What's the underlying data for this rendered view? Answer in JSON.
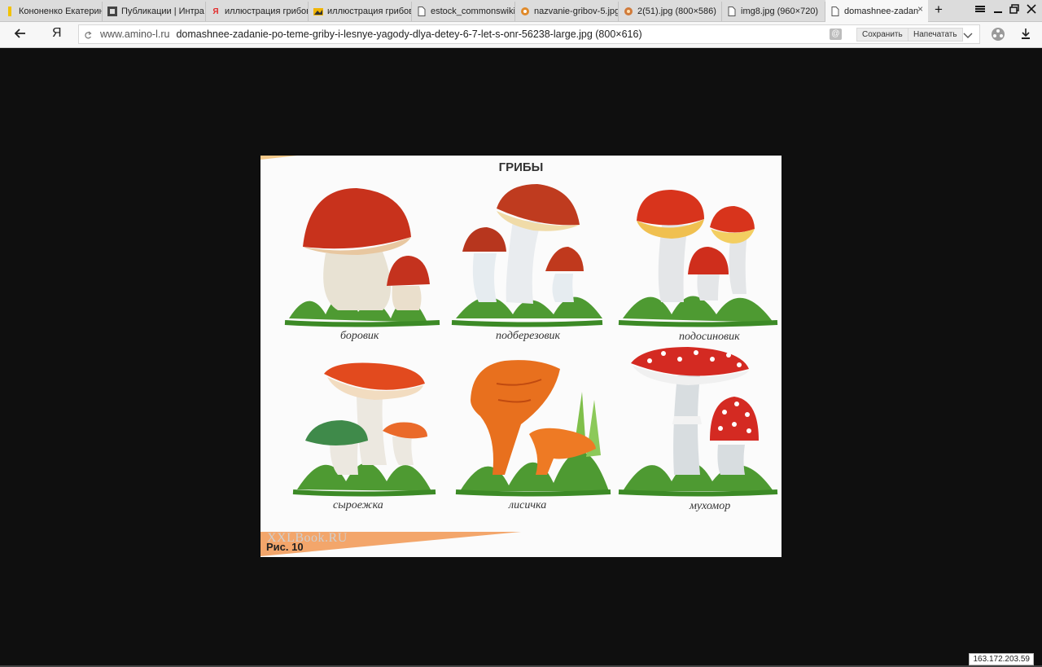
{
  "tabs": [
    {
      "label": "Кононенко Екатерин",
      "icon": "yellow-bookmark-icon",
      "color": "#f2c200"
    },
    {
      "label": "Публикации | Интра",
      "icon": "site-favicon-icon",
      "color": "#444444"
    },
    {
      "label": "иллюстрация грибов",
      "icon": "yandex-icon",
      "color": "#e22b2b"
    },
    {
      "label": "иллюстрация грибов",
      "icon": "yandex-images-icon",
      "color": "#f0b400"
    },
    {
      "label": "estock_commonswiki",
      "icon": "page-icon",
      "color": "#555555"
    },
    {
      "label": "nazvanie-gribov-5.jpg",
      "icon": "image-favicon-icon",
      "color": "#e08a2a"
    },
    {
      "label": "2(51).jpg (800×586)",
      "icon": "image-favicon-icon",
      "color": "#d07a3a"
    },
    {
      "label": "img8.jpg (960×720)",
      "icon": "page-icon",
      "color": "#555555"
    },
    {
      "label": "domashnee-zadan",
      "icon": "page-icon",
      "color": "#555555",
      "active": true
    }
  ],
  "toolbar": {
    "yandex_logo": "Я",
    "domain": "www.amino-l.ru",
    "url_path": "domashnee-zadanie-po-teme-griby-i-lesnye-yagody-dlya-detey-6-7-let-s-onr-56238-large.jpg (800×616)",
    "save_label": "Сохранить",
    "print_label": "Напечатать"
  },
  "image": {
    "title": "ГРИБЫ",
    "captions": [
      "боровик",
      "подберезовик",
      "подосиновик",
      "сыроежка",
      "лисичка",
      "мухомор"
    ],
    "watermark": "XXLBook.RU",
    "figure_label": "Рис. 10"
  },
  "status": {
    "ip": "163.172.203.59"
  }
}
